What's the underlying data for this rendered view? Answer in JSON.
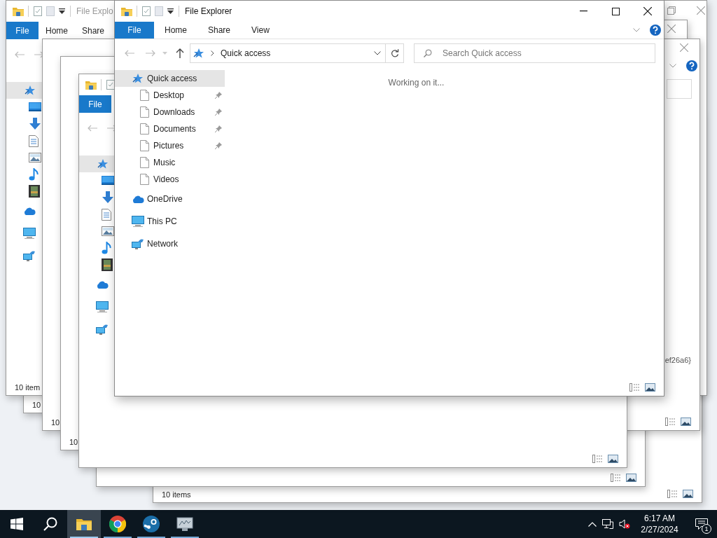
{
  "background_windows": [
    {
      "kind": "explorer",
      "title": "File Explo",
      "ribbon_tabs": [
        {
          "label": "File",
          "selected": true
        },
        {
          "label": "Home",
          "selected": false
        },
        {
          "label": "Share",
          "selected": false
        }
      ],
      "status": "10 item"
    },
    {
      "kind": "explorer",
      "status": "10"
    },
    {
      "kind": "explorer"
    },
    {
      "kind": "explorer",
      "fragment": "ef26a6}",
      "status": "10"
    },
    {
      "kind": "explorer",
      "status": "10"
    },
    {
      "kind": "explorer",
      "ribbon_tabs": [
        {
          "label": "File",
          "selected": true
        }
      ]
    },
    {
      "kind": "explorer"
    },
    {
      "kind": "explorer",
      "status": "10 items"
    }
  ],
  "window": {
    "title": "File Explorer",
    "ribbon_tabs": [
      {
        "label": "File",
        "selected": true
      },
      {
        "label": "Home",
        "selected": false
      },
      {
        "label": "Share",
        "selected": false
      },
      {
        "label": "View",
        "selected": false
      }
    ],
    "address": "Quick access",
    "search": {
      "placeholder": "Search Quick access"
    },
    "nav": [
      {
        "label": "Quick access",
        "kind": "quick",
        "selected": true,
        "children": [
          {
            "label": "Desktop",
            "pinned": true
          },
          {
            "label": "Downloads",
            "pinned": true
          },
          {
            "label": "Documents",
            "pinned": true
          },
          {
            "label": "Pictures",
            "pinned": true
          },
          {
            "label": "Music",
            "pinned": false
          },
          {
            "label": "Videos",
            "pinned": false
          }
        ]
      },
      {
        "label": "OneDrive",
        "kind": "cloud",
        "selected": false
      },
      {
        "label": "This PC",
        "kind": "pc",
        "selected": false
      },
      {
        "label": "Network",
        "kind": "network",
        "selected": false
      }
    ],
    "message": "Working on it..."
  },
  "taskbar": {
    "apps": [
      {
        "kind": "explorer",
        "selected": true
      },
      {
        "kind": "chrome",
        "selected": false
      },
      {
        "kind": "steam",
        "selected": false
      },
      {
        "kind": "monitor",
        "selected": false
      }
    ],
    "time": "6:17 AM",
    "date": "2/27/2024",
    "notifications": "1"
  }
}
